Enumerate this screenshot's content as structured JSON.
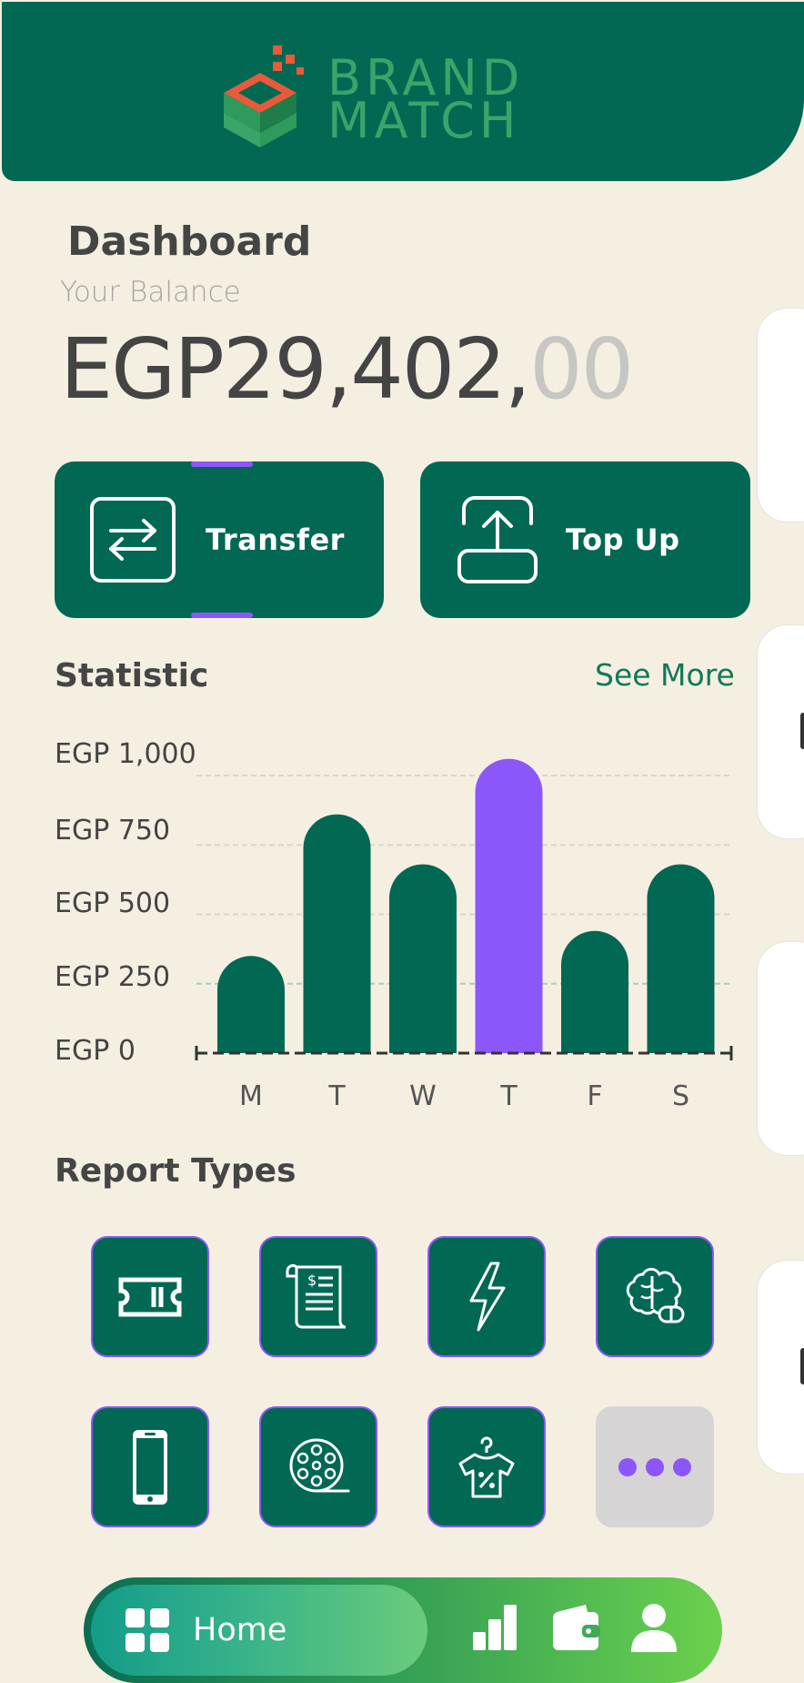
{
  "brand": {
    "line1": "BRAND",
    "line2": "MATCH"
  },
  "dashboard": {
    "title": "Dashboard",
    "balance_label": "Your Balance",
    "balance_main": "EGP29,402,",
    "balance_decimals": "00"
  },
  "actions": {
    "transfer_label": "Transfer",
    "topup_label": "Top Up"
  },
  "statistic": {
    "title": "Statistic",
    "see_more": "See More"
  },
  "chart_data": {
    "type": "bar",
    "categories": [
      "M",
      "T",
      "W",
      "T",
      "F",
      "S"
    ],
    "values": [
      350,
      860,
      680,
      1060,
      440,
      680
    ],
    "highlight_index": 3,
    "y_ticks": [
      {
        "value": 0,
        "label": "EGP 0"
      },
      {
        "value": 250,
        "label": "EGP 250"
      },
      {
        "value": 500,
        "label": "EGP 500"
      },
      {
        "value": 750,
        "label": "EGP 750"
      },
      {
        "value": 1000,
        "label": "EGP 1,000"
      }
    ],
    "ylim": [
      0,
      1000
    ],
    "grid": true,
    "colors": {
      "bar": "#006853",
      "highlight": "#8c57fa"
    }
  },
  "report_types": {
    "title": "Report Types",
    "items": [
      {
        "icon": "ticket-icon"
      },
      {
        "icon": "receipt-icon"
      },
      {
        "icon": "lightning-icon"
      },
      {
        "icon": "brain-icon"
      },
      {
        "icon": "mobile-phone-icon"
      },
      {
        "icon": "film-reel-icon"
      },
      {
        "icon": "clothing-sale-icon"
      },
      {
        "icon": "more-icon"
      }
    ]
  },
  "nav": {
    "home_label": "Home",
    "items": [
      "home-icon",
      "stats-icon",
      "wallet-icon",
      "profile-icon"
    ]
  },
  "colors": {
    "primary": "#006853",
    "accent": "#8c57fa",
    "background": "#f5efe2",
    "logo_green": "#3aa56a",
    "logo_orange": "#e85a3a"
  }
}
